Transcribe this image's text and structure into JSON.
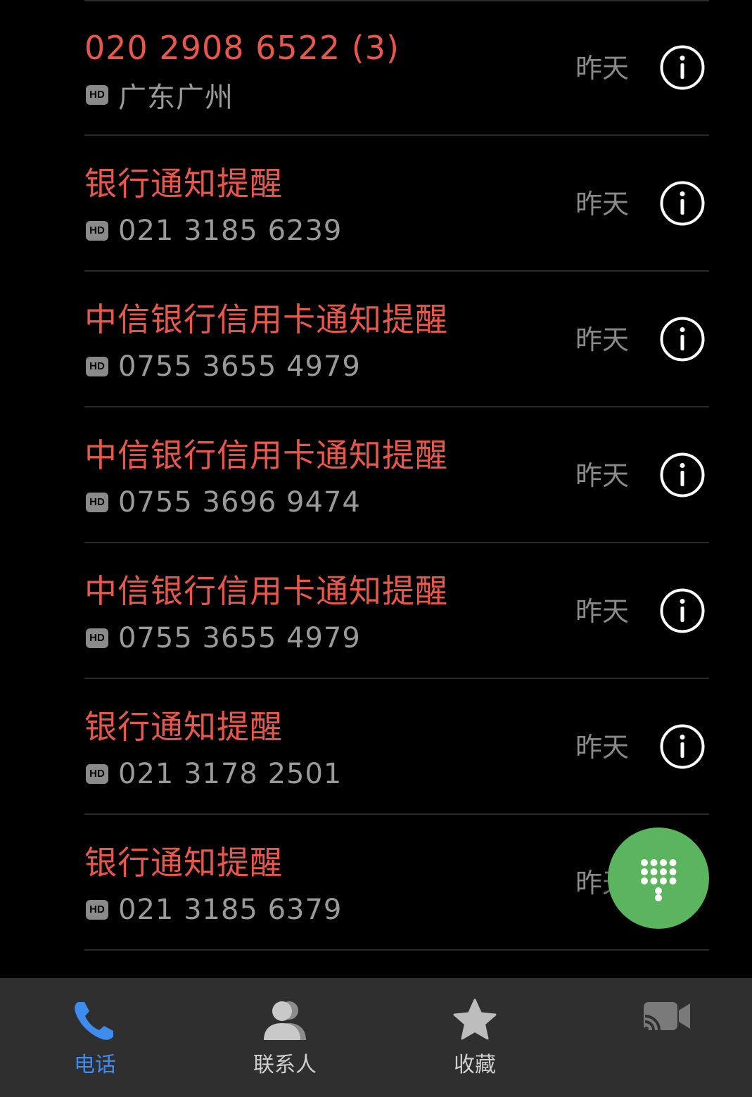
{
  "colors": {
    "missed_call": "#e8574c",
    "secondary_text": "#9a9a9a",
    "accent": "#3f8cf0",
    "fab": "#5bb55e",
    "nav_bg": "#2f2f2f"
  },
  "calls": [
    {
      "title": "020 2908 6522 (3)",
      "subtitle": "广东广州",
      "date": "昨天",
      "badge": "HD"
    },
    {
      "title": "银行通知提醒",
      "subtitle": "021 3185 6239",
      "date": "昨天",
      "badge": "HD"
    },
    {
      "title": "中信银行信用卡通知提醒",
      "subtitle": "0755 3655 4979",
      "date": "昨天",
      "badge": "HD"
    },
    {
      "title": "中信银行信用卡通知提醒",
      "subtitle": "0755 3696 9474",
      "date": "昨天",
      "badge": "HD"
    },
    {
      "title": "中信银行信用卡通知提醒",
      "subtitle": "0755 3655 4979",
      "date": "昨天",
      "badge": "HD"
    },
    {
      "title": "银行通知提醒",
      "subtitle": "021 3178 2501",
      "date": "昨天",
      "badge": "HD"
    },
    {
      "title": "银行通知提醒",
      "subtitle": "021 3185 6379",
      "date": "昨天",
      "badge": "HD"
    }
  ],
  "fab": {
    "icon": "dialpad-icon"
  },
  "nav": [
    {
      "label": "电话",
      "icon": "phone-icon",
      "active": true
    },
    {
      "label": "联系人",
      "icon": "contacts-icon",
      "active": false
    },
    {
      "label": "收藏",
      "icon": "star-icon",
      "active": false
    },
    {
      "label": "",
      "icon": "video-call-icon",
      "active": false
    }
  ]
}
